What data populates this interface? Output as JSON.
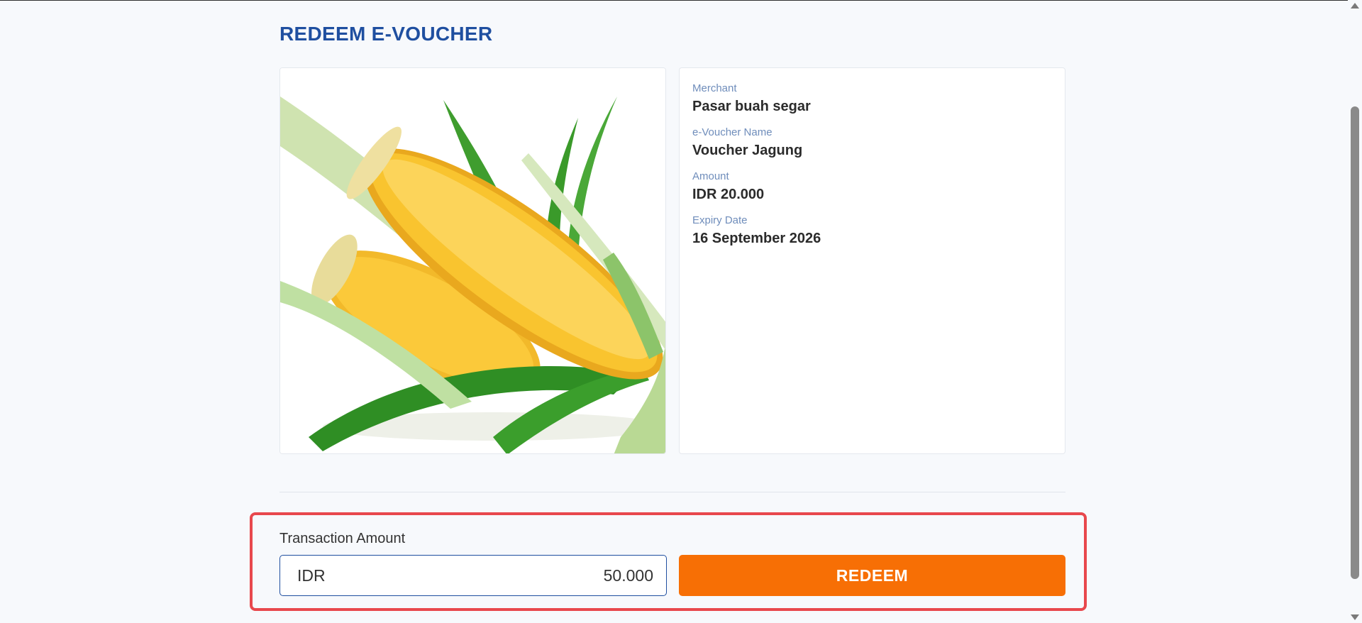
{
  "page": {
    "title": "REDEEM E-VOUCHER"
  },
  "voucher": {
    "image_alt": "corn-image",
    "fields": [
      {
        "label": "Merchant",
        "value": "Pasar buah segar"
      },
      {
        "label": "e-Voucher Name",
        "value": "Voucher Jagung"
      },
      {
        "label": "Amount",
        "value": "IDR 20.000"
      },
      {
        "label": "Expiry Date",
        "value": "16 September 2026"
      }
    ]
  },
  "transaction": {
    "label": "Transaction Amount",
    "currency": "IDR",
    "value": "50.000"
  },
  "actions": {
    "redeem_label": "REDEEM"
  },
  "colors": {
    "title": "#1f4fa0",
    "label": "#6f8dbb",
    "accent_button": "#f76f05",
    "input_border": "#1f4fa0",
    "highlight_border": "#e8484d",
    "background": "#f7f9fc"
  },
  "icons": {
    "scroll_up": "triangle-up-icon",
    "scroll_down": "triangle-down-icon"
  }
}
